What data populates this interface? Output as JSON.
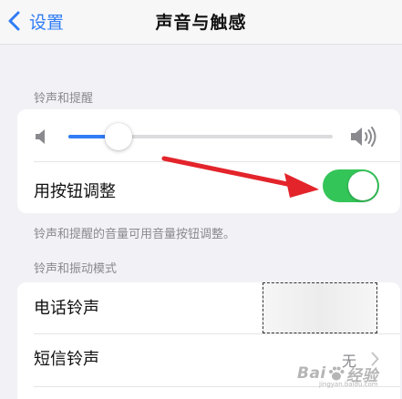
{
  "navbar": {
    "back_label": "设置",
    "title": "声音与触感"
  },
  "ringer_section": {
    "header": "铃声和提醒",
    "volume_level": 0.19,
    "adjust_with_buttons_label": "用按钮调整",
    "adjust_with_buttons_on": true,
    "footer": "铃声和提醒的音量可用音量按钮调整。"
  },
  "patterns_section": {
    "header": "铃声和振动模式",
    "items": [
      {
        "label": "电话铃声",
        "value": ""
      },
      {
        "label": "短信铃声",
        "value": "无"
      }
    ]
  },
  "watermark": {
    "text_left": "Bai",
    "text_right": "经验",
    "subtext": "jingyan.baidu.com"
  },
  "colors": {
    "accent": "#2f7cf6",
    "toggle_on": "#34c559",
    "annotation_arrow": "#e3242b",
    "background": "#f2f2f6"
  },
  "icons": {
    "back": "chevron-left-icon",
    "volume_low": "speaker-low-icon",
    "volume_high": "speaker-high-icon",
    "disclosure": "chevron-right-icon"
  }
}
